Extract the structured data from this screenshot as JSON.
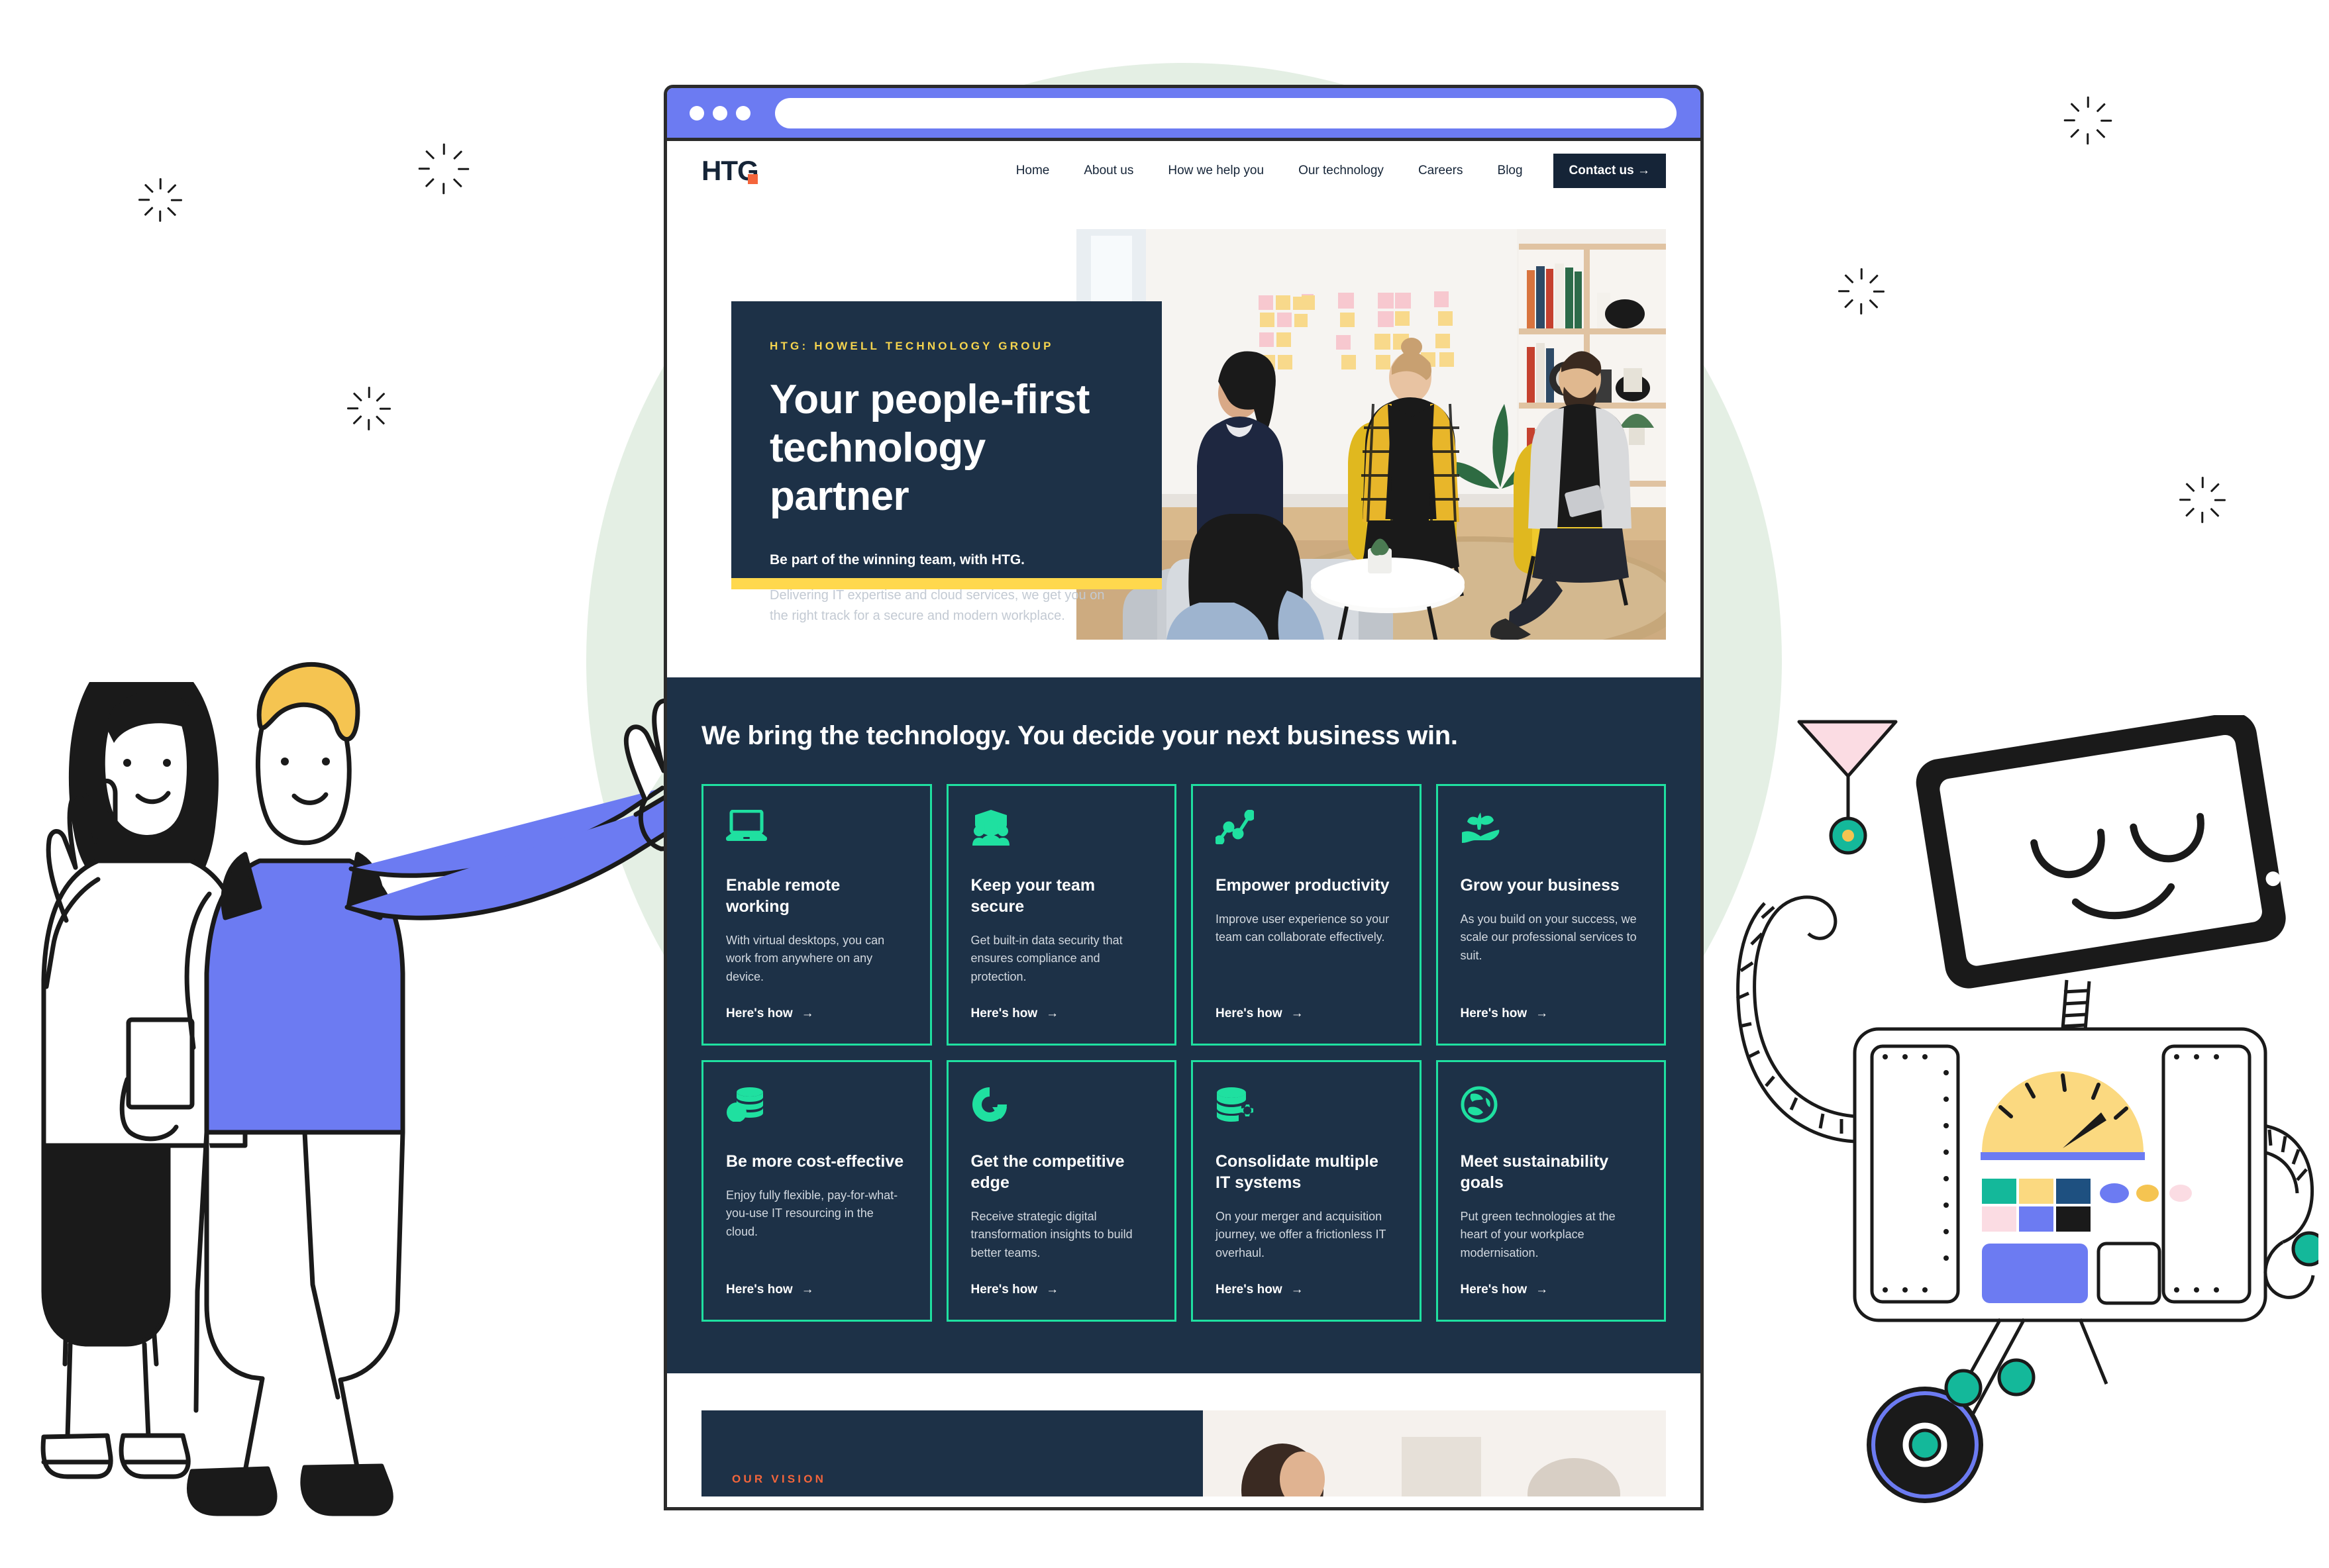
{
  "browser": {
    "dots": [
      "window-dot-1",
      "window-dot-2",
      "window-dot-3"
    ],
    "url_value": "",
    "url_placeholder": ""
  },
  "site": {
    "logo_text": "HTG",
    "logo_accent_color": "#F4653B",
    "nav": [
      {
        "label": "Home"
      },
      {
        "label": "About us"
      },
      {
        "label": "How we help you"
      },
      {
        "label": "Our technology"
      },
      {
        "label": "Careers"
      },
      {
        "label": "Blog"
      }
    ],
    "cta": {
      "label": "Contact us  →"
    }
  },
  "hero": {
    "eyebrow": "HTG: Howell Technology Group",
    "heading_line1": "Your people-first",
    "heading_line2": "technology partner",
    "lead": "Be part of the winning team, with HTG.",
    "body": "Delivering IT expertise and cloud services, we get you on the right track for a secure and modern workplace.",
    "accent_bar_color": "#FFD84D",
    "panel_color": "#1D3147"
  },
  "features": {
    "heading": "We bring the technology. You decide your next business win.",
    "link_label": "Here's how",
    "link_arrow": "→",
    "accent_color": "#1FE0A0",
    "cards": [
      {
        "icon": "laptop-icon",
        "title": "Enable remote working",
        "body": "With virtual desktops, you can work from anywhere on any device."
      },
      {
        "icon": "shield-people-icon",
        "title": "Keep your team secure",
        "body": "Get built-in data security that ensures compliance and protection."
      },
      {
        "icon": "trending-line-chart-icon",
        "title": "Empower productivity",
        "body": "Improve user experience so your team can collaborate effectively."
      },
      {
        "icon": "hand-sprout-icon",
        "title": "Grow your business",
        "body": "As you build on your success, we scale our professional services to suit."
      },
      {
        "icon": "coins-icon",
        "title": "Be more cost-effective",
        "body": "Enjoy fully flexible, pay-for-what-you-use IT resourcing in the cloud."
      },
      {
        "icon": "donut-chart-icon",
        "title": "Get the competitive edge",
        "body": "Receive strategic digital transformation insights to build better teams."
      },
      {
        "icon": "database-gear-icon",
        "title": "Consolidate multiple IT systems",
        "body": "On your merger and acquisition journey, we offer a frictionless IT overhaul."
      },
      {
        "icon": "globe-icon",
        "title": "Meet sustainability goals",
        "body": "Put green technologies at the heart of your workplace modernisation."
      }
    ]
  },
  "vision": {
    "label": "Our vision",
    "label_color": "#F4653B"
  }
}
